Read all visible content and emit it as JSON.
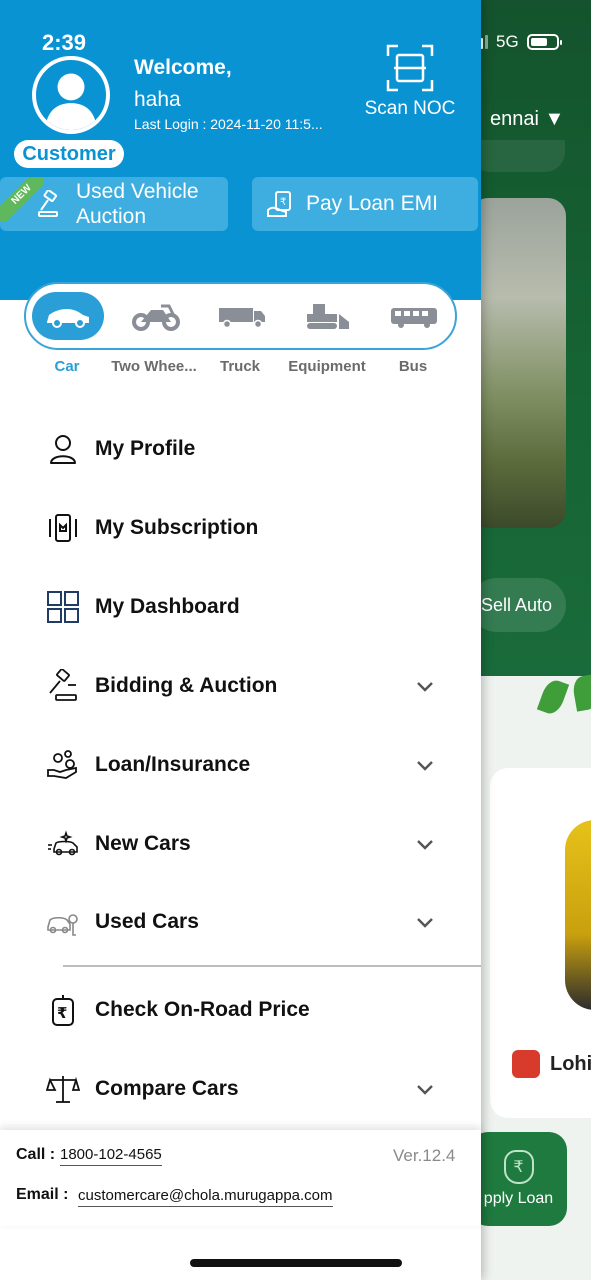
{
  "status_bar": {
    "time": "2:39",
    "network": "5G",
    "signal_bars": 3,
    "battery_level": 0.7
  },
  "background_app": {
    "city": "ennai",
    "sell_label": "Sell Auto",
    "card_title": "Lohi",
    "apply_loan_label": "pply Loan"
  },
  "drawer": {
    "header": {
      "welcome": "Welcome,",
      "username": "haha",
      "last_login": "Last Login : 2024-11-20 11:5...",
      "role": "Customer",
      "scan_noc": "Scan NOC",
      "accent": "#0a93d3"
    },
    "quick_actions": {
      "auction_line1": "Used Vehicle",
      "auction_line2": "Auction",
      "new_badge": "NEW",
      "emi": "Pay Loan EMI"
    },
    "vehicle_types": [
      {
        "label": "Car",
        "icon": "car-icon",
        "active": true
      },
      {
        "label": "Two Wheeler",
        "display": "Two Whee...",
        "icon": "motorcycle-icon",
        "active": false
      },
      {
        "label": "Truck",
        "icon": "truck-icon",
        "active": false
      },
      {
        "label": "Equipment",
        "icon": "bulldozer-icon",
        "active": false
      },
      {
        "label": "Bus",
        "icon": "bus-icon",
        "active": false
      }
    ],
    "menu": [
      {
        "label": "My Profile",
        "icon": "user-icon",
        "expandable": false
      },
      {
        "label": "My Subscription",
        "icon": "subscription-icon",
        "expandable": false
      },
      {
        "label": "My Dashboard",
        "icon": "dashboard-grid-icon",
        "expandable": false
      },
      {
        "label": "Bidding & Auction",
        "icon": "gavel-icon",
        "expandable": true
      },
      {
        "label": "Loan/Insurance",
        "icon": "loan-hand-icon",
        "expandable": true
      },
      {
        "label": "New Cars",
        "icon": "new-car-icon",
        "expandable": true
      },
      {
        "label": "Used Cars",
        "icon": "used-car-icon",
        "expandable": true
      },
      {
        "label": "Check On-Road Price",
        "icon": "rupee-tag-icon",
        "expandable": false
      },
      {
        "label": "Compare Cars",
        "icon": "scale-icon",
        "expandable": true
      }
    ],
    "footer": {
      "call_label": "Call :",
      "call_number": "1800-102-4565",
      "version": "Ver.12.4",
      "email_label": "Email :",
      "email": "customercare@chola.murugappa.com"
    }
  }
}
